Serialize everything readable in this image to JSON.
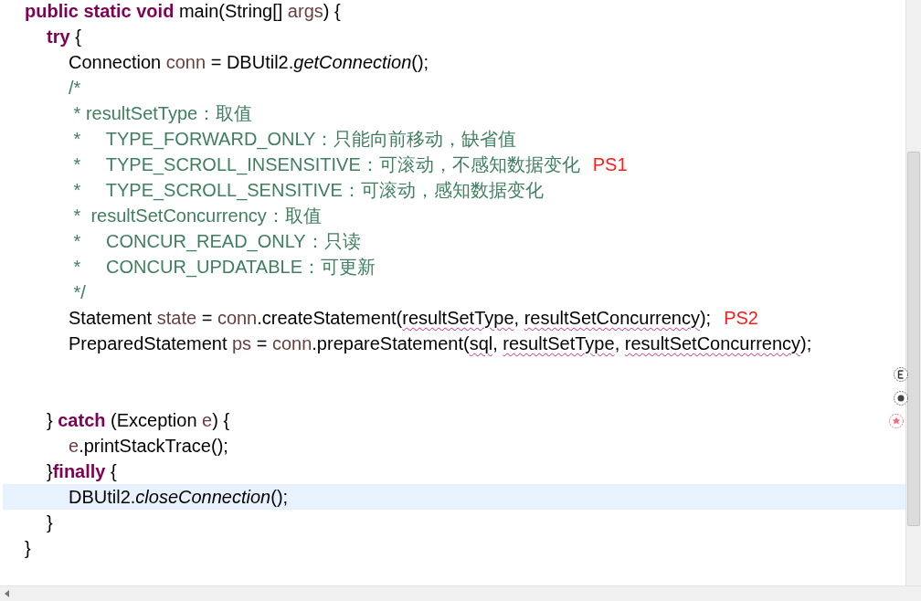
{
  "editor": {
    "lines": [
      {
        "highlighted": false,
        "tokens": [
          {
            "kind": "keyword",
            "text": "public static void"
          },
          {
            "kind": "plain",
            "text": " main(String[] "
          },
          {
            "kind": "variable",
            "text": "args"
          },
          {
            "kind": "plain",
            "text": ") {"
          }
        ],
        "children": [
          {
            "highlighted": false,
            "tokens": [
              {
                "kind": "keyword",
                "text": "try"
              },
              {
                "kind": "plain",
                "text": " {"
              }
            ],
            "children": [
              {
                "highlighted": false,
                "tokens": [
                  {
                    "kind": "plain",
                    "text": "Connection "
                  },
                  {
                    "kind": "variable",
                    "text": "conn"
                  },
                  {
                    "kind": "plain",
                    "text": " = DBUtil2."
                  },
                  {
                    "kind": "static",
                    "text": "getConnection"
                  },
                  {
                    "kind": "plain",
                    "text": "();"
                  }
                ]
              },
              {
                "highlighted": false,
                "tokens": [
                  {
                    "kind": "comment",
                    "text": "/*"
                  }
                ]
              },
              {
                "highlighted": false,
                "tokens": [
                  {
                    "kind": "comment",
                    "text": " * resultSetType：取值"
                  }
                ]
              },
              {
                "highlighted": false,
                "tokens": [
                  {
                    "kind": "comment",
                    "text": " *     TYPE_FORWARD_ONLY：只能向前移动，缺省值"
                  }
                ]
              },
              {
                "highlighted": false,
                "tokens": [
                  {
                    "kind": "comment",
                    "text": " *     TYPE_SCROLL_INSENSITIVE：可滚动，不感知数据变化"
                  },
                  {
                    "kind": "note",
                    "text": "PS1"
                  }
                ]
              },
              {
                "highlighted": false,
                "tokens": [
                  {
                    "kind": "comment",
                    "text": " *     TYPE_SCROLL_SENSITIVE：可滚动，感知数据变化"
                  }
                ]
              },
              {
                "highlighted": false,
                "tokens": [
                  {
                    "kind": "comment",
                    "text": " *  resultSetConcurrency：取值"
                  }
                ]
              },
              {
                "highlighted": false,
                "tokens": [
                  {
                    "kind": "comment",
                    "text": " *     CONCUR_READ_ONLY：只读"
                  }
                ]
              },
              {
                "highlighted": false,
                "tokens": [
                  {
                    "kind": "comment",
                    "text": " *     CONCUR_UPDATABLE：可更新"
                  }
                ]
              },
              {
                "highlighted": false,
                "tokens": [
                  {
                    "kind": "comment",
                    "text": " */"
                  }
                ]
              },
              {
                "highlighted": false,
                "tokens": [
                  {
                    "kind": "plain",
                    "text": "Statement "
                  },
                  {
                    "kind": "variable",
                    "text": "state"
                  },
                  {
                    "kind": "plain",
                    "text": " = "
                  },
                  {
                    "kind": "variable",
                    "text": "conn"
                  },
                  {
                    "kind": "plain",
                    "text": ".createStatement("
                  },
                  {
                    "kind": "error",
                    "text": "resultSetType"
                  },
                  {
                    "kind": "plain",
                    "text": ", "
                  },
                  {
                    "kind": "error",
                    "text": "resultSetConcurrency"
                  },
                  {
                    "kind": "plain",
                    "text": ");"
                  },
                  {
                    "kind": "note",
                    "text": "PS2"
                  }
                ]
              },
              {
                "highlighted": false,
                "tokens": [
                  {
                    "kind": "plain",
                    "text": "PreparedStatement "
                  },
                  {
                    "kind": "variable",
                    "text": "ps"
                  },
                  {
                    "kind": "plain",
                    "text": " = "
                  },
                  {
                    "kind": "variable",
                    "text": "conn"
                  },
                  {
                    "kind": "plain",
                    "text": ".prepareStatement("
                  },
                  {
                    "kind": "error",
                    "text": "sql"
                  },
                  {
                    "kind": "plain",
                    "text": ", "
                  },
                  {
                    "kind": "error",
                    "text": "resultSetType"
                  },
                  {
                    "kind": "plain",
                    "text": ", "
                  },
                  {
                    "kind": "error",
                    "text": "resultSetConcurrency"
                  },
                  {
                    "kind": "plain",
                    "text": ");"
                  }
                ]
              },
              {
                "highlighted": false
              },
              {
                "highlighted": false
              }
            ]
          },
          {
            "highlighted": false,
            "tokens": [
              {
                "kind": "plain",
                "text": "} "
              },
              {
                "kind": "keyword",
                "text": "catch"
              },
              {
                "kind": "plain",
                "text": " (Exception "
              },
              {
                "kind": "variable",
                "text": "e"
              },
              {
                "kind": "plain",
                "text": ") {"
              }
            ],
            "children": [
              {
                "highlighted": false,
                "tokens": [
                  {
                    "kind": "variable",
                    "text": "e"
                  },
                  {
                    "kind": "plain",
                    "text": ".printStackTrace();"
                  }
                ]
              }
            ]
          },
          {
            "highlighted": false,
            "tokens": [
              {
                "kind": "plain",
                "text": "}"
              },
              {
                "kind": "keyword",
                "text": "finally"
              },
              {
                "kind": "plain",
                "text": " {"
              }
            ],
            "children": [
              {
                "highlighted": true,
                "tokens": [
                  {
                    "kind": "plain",
                    "text": "DBUtil2."
                  },
                  {
                    "kind": "static",
                    "text": "closeConnection"
                  },
                  {
                    "kind": "plain",
                    "text": "();"
                  }
                ]
              }
            ]
          },
          {
            "highlighted": false,
            "tokens": [
              {
                "kind": "plain",
                "text": "}"
              }
            ]
          }
        ]
      },
      {
        "highlighted": false,
        "tokens": [
          {
            "kind": "plain",
            "text": "}"
          }
        ]
      }
    ]
  }
}
